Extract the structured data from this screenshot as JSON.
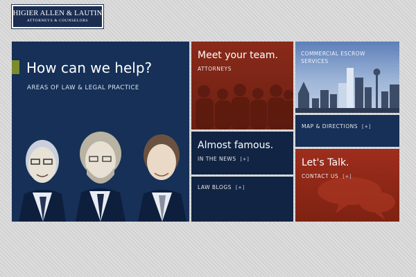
{
  "logo": {
    "name": "HIGIER ALLEN & LAUTIN",
    "tagline": "ATTORNEYS & COUNSELORS"
  },
  "help": {
    "title": "How can we help?",
    "subtitle": "AREAS OF LAW & LEGAL PRACTICE"
  },
  "team": {
    "title": "Meet your team.",
    "link": "ATTORNEYS"
  },
  "escrow": {
    "link": "COMMERCIAL ESCROW SERVICES"
  },
  "map": {
    "link": "MAP & DIRECTIONS",
    "icon": "[+]"
  },
  "famous": {
    "title": "Almost famous.",
    "link": "IN THE NEWS",
    "icon": "[+]"
  },
  "blogs": {
    "link": "LAW BLOGS",
    "icon": "[+]"
  },
  "talk": {
    "title": "Let's Talk.",
    "link": "CONTACT US",
    "icon": "[+]"
  },
  "colors": {
    "navy": "#163057",
    "dark_navy": "#122443",
    "red": "#8a2a1a",
    "olive_accent": "#7a8c2c"
  }
}
